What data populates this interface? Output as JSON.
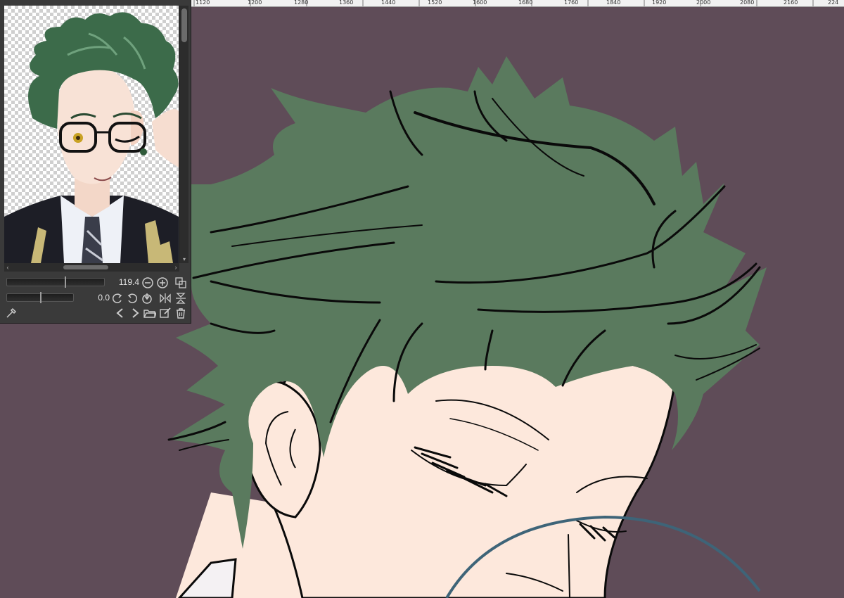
{
  "ruler": {
    "labels": [
      "1120",
      "1200",
      "1280",
      "1360",
      "1440",
      "1520",
      "1600",
      "1680",
      "1760",
      "1840",
      "1920",
      "2000",
      "2080",
      "2160",
      "224"
    ]
  },
  "navigator": {
    "zoom_value": "119.4",
    "rotation_value": "0.0"
  },
  "colors": {
    "canvas_bg": "#5f4c58",
    "hair": "#5a7a5e",
    "skin": "#fde8dc",
    "lineart": "#0a0a0a",
    "brush_cursor": "#3e6478",
    "panel_bg": "#3a3a3a"
  },
  "icons": {
    "zoom_out": "zoom-out-icon",
    "zoom_in": "zoom-in-icon",
    "fit": "fit-view-icon",
    "rotate_left": "rotate-left-icon",
    "rotate_right": "rotate-right-icon",
    "reset_rotation": "reset-rotation-icon",
    "flip_h": "flip-horizontal-icon",
    "flip_v": "flip-vertical-icon",
    "eyedropper": "eyedropper-icon",
    "prev": "previous-icon",
    "next": "next-icon",
    "open_folder": "open-folder-icon",
    "edit": "edit-icon",
    "delete": "trash-icon"
  }
}
